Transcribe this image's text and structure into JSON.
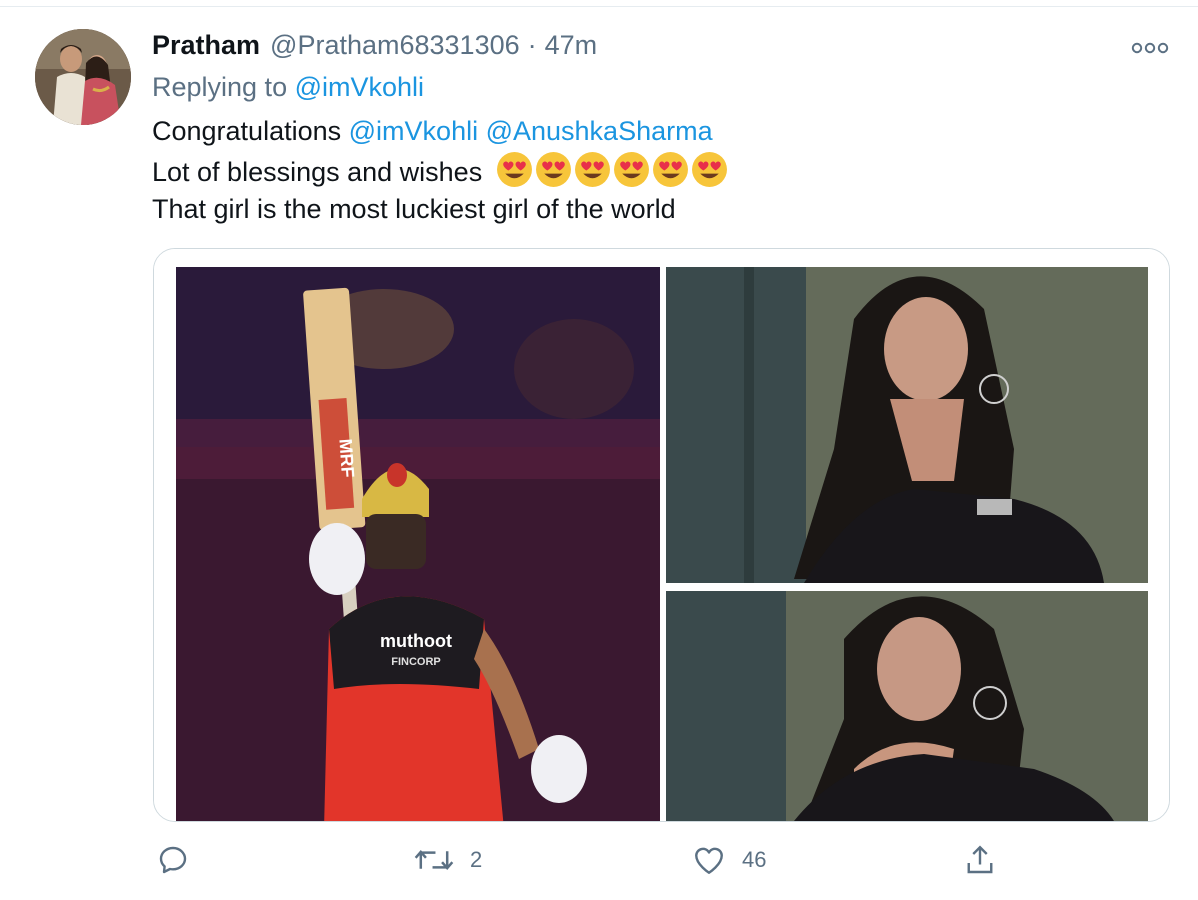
{
  "tweet": {
    "display_name": "Pratham",
    "handle": "@Pratham68331306",
    "separator": "·",
    "time": "47m",
    "replying_label": "Replying to",
    "replying_to": "@imVkohli",
    "body": {
      "line1_prefix": "Congratulations",
      "mention1": "@imVkohli",
      "mention2": "@AnushkaSharma",
      "line2": "Lot of blessings  and wishes",
      "line2_emoji_count": 6,
      "line3": "That girl is the most luckiest girl  of the world"
    },
    "media": {
      "bat_logo_text": "MRF",
      "jersey_brand": "muthoot",
      "jersey_sub": "FINCORP"
    }
  },
  "actions": {
    "reply": {
      "icon": "reply-icon",
      "count": ""
    },
    "retweet": {
      "icon": "retweet-icon",
      "count": "2"
    },
    "like": {
      "icon": "heart-icon",
      "count": "46"
    },
    "share": {
      "icon": "share-icon",
      "count": ""
    }
  },
  "colors": {
    "accent": "#1b95e0",
    "secondary_text": "#5b7083",
    "primary_text": "#0f1419",
    "border": "#cfd9de"
  }
}
